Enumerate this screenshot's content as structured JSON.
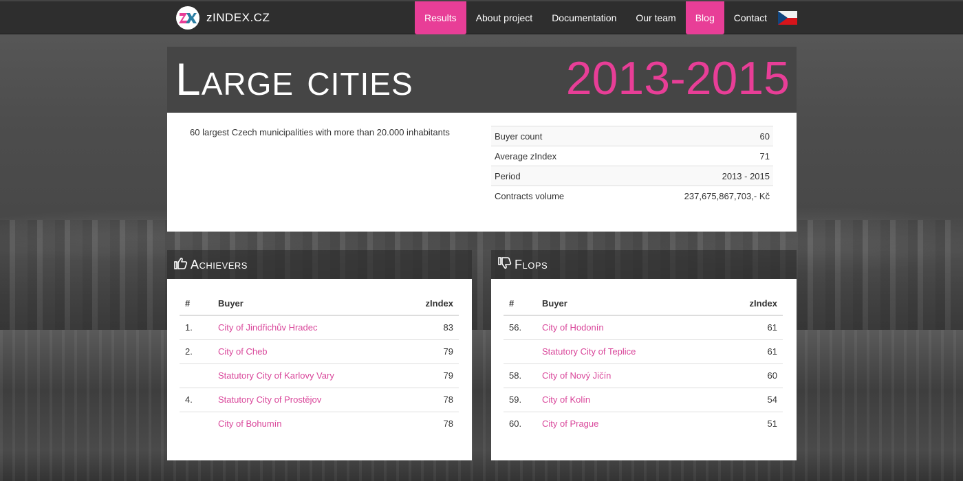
{
  "brand": {
    "name": "zINDEX.CZ",
    "logo_icon": "zindex-logo-icon"
  },
  "nav": {
    "items": [
      {
        "label": "Results",
        "active": true
      },
      {
        "label": "About project",
        "active": false
      },
      {
        "label": "Documentation",
        "active": false
      },
      {
        "label": "Our team",
        "active": false
      },
      {
        "label": "Blog",
        "active": true
      },
      {
        "label": "Contact",
        "active": false
      }
    ],
    "language_icon": "czech-flag-icon"
  },
  "banner": {
    "title": "Large cities",
    "period": "2013-2015"
  },
  "summary": {
    "description": "60 largest Czech municipalities with more than 20.000 inhabitants",
    "stats": [
      {
        "label": "Buyer count",
        "value": "60"
      },
      {
        "label": "Average zIndex",
        "value": "71"
      },
      {
        "label": "Period",
        "value": "2013 - 2015"
      },
      {
        "label": "Contracts volume",
        "value": "237,675,867,703,- Kč"
      }
    ]
  },
  "achievers": {
    "title": "Achievers",
    "icon": "thumbs-up-icon",
    "columns": {
      "rank": "#",
      "buyer": "Buyer",
      "zindex": "zIndex"
    },
    "rows": [
      {
        "rank": "1.",
        "buyer": "City of Jindřichův Hradec",
        "zindex": "83"
      },
      {
        "rank": "2.",
        "buyer": "City of Cheb",
        "zindex": "79"
      },
      {
        "rank": "",
        "buyer": "Statutory City of Karlovy Vary",
        "zindex": "79"
      },
      {
        "rank": "4.",
        "buyer": "Statutory City of Prostějov",
        "zindex": "78"
      },
      {
        "rank": "",
        "buyer": "City of Bohumín",
        "zindex": "78"
      }
    ]
  },
  "flops": {
    "title": "Flops",
    "icon": "thumbs-down-icon",
    "columns": {
      "rank": "#",
      "buyer": "Buyer",
      "zindex": "zIndex"
    },
    "rows": [
      {
        "rank": "56.",
        "buyer": "City of Hodonín",
        "zindex": "61"
      },
      {
        "rank": "",
        "buyer": "Statutory City of Teplice",
        "zindex": "61"
      },
      {
        "rank": "58.",
        "buyer": "City of Nový Jičín",
        "zindex": "60"
      },
      {
        "rank": "59.",
        "buyer": "City of Kolín",
        "zindex": "54"
      },
      {
        "rank": "60.",
        "buyer": "City of Prague",
        "zindex": "51"
      }
    ]
  },
  "colors": {
    "accent": "#e83e97",
    "link": "#d9469a",
    "navbar": "#2e2e2e"
  }
}
